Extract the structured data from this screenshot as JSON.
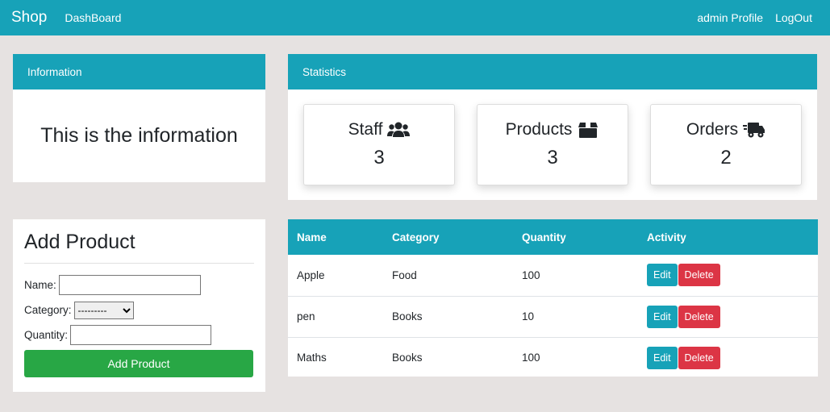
{
  "navbar": {
    "brand": "Shop",
    "dashboard": "DashBoard",
    "profile": "admin Profile",
    "logout": "LogOut"
  },
  "information": {
    "header": "Information",
    "text": "This is the information"
  },
  "statistics": {
    "header": "Statistics",
    "items": [
      {
        "label": "Staff",
        "value": "3",
        "icon": "users-icon"
      },
      {
        "label": "Products",
        "value": "3",
        "icon": "box-icon"
      },
      {
        "label": "Orders",
        "value": "2",
        "icon": "truck-icon"
      }
    ]
  },
  "add_product": {
    "title": "Add Product",
    "name_label": "Name:",
    "name_value": "",
    "category_label": "Category:",
    "category_selected": "---------",
    "quantity_label": "Quantity:",
    "quantity_value": "",
    "submit_label": "Add Product"
  },
  "table": {
    "headers": [
      "Name",
      "Category",
      "Quantity",
      "Activity"
    ],
    "rows": [
      {
        "name": "Apple",
        "category": "Food",
        "quantity": "100"
      },
      {
        "name": "pen",
        "category": "Books",
        "quantity": "10"
      },
      {
        "name": "Maths",
        "category": "Books",
        "quantity": "100"
      }
    ],
    "edit_label": "Edit",
    "delete_label": "Delete"
  },
  "colors": {
    "primary": "#17a2b8",
    "success": "#28a745",
    "danger": "#dc3545",
    "background": "#e6e2e1"
  }
}
